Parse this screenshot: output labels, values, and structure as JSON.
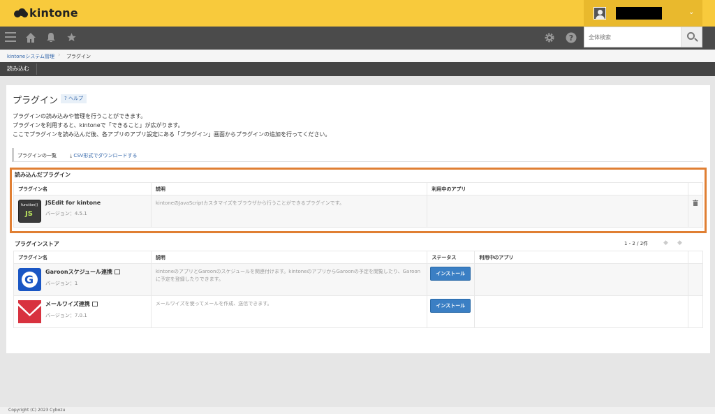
{
  "header": {
    "brand": "kintone",
    "user_name": "",
    "search_placeholder": "全体検索"
  },
  "breadcrumb": {
    "items": [
      "kintoneシステム管理",
      "プラグイン"
    ]
  },
  "actionbar": {
    "import_label": "読み込む"
  },
  "page": {
    "title": "プラグイン",
    "help_label": "? ヘルプ",
    "description": [
      "プラグインの読み込みや管理を行うことができます。",
      "プラグインを利用すると、kintoneで「できること」が広がります。",
      "ここでプラグインを読み込んだ後、各アプリのアプリ設定にある「プラグイン」画面からプラグインの追加を行ってください。"
    ],
    "list_label": "プラグインの一覧",
    "csv_link": "CSV形式でダウンロードする"
  },
  "loaded": {
    "title": "読み込んだプラグイン",
    "columns": [
      "プラグイン名",
      "説明",
      "利用中のアプリ"
    ],
    "rows": [
      {
        "name": "JSEdit for kintone",
        "version": "バージョン：4.5.1",
        "description": "kintoneのJavaScriptカスタマイズをブラウザから行うことができるプラグインです。",
        "apps": "",
        "icon_top": "function()",
        "icon_main": "JS"
      }
    ]
  },
  "store": {
    "title": "プラグインストア",
    "pager": "1 - 2 / 2件",
    "columns": [
      "プラグイン名",
      "説明",
      "ステータス",
      "利用中のアプリ"
    ],
    "rows": [
      {
        "name": "Garoonスケジュール連携",
        "version": "バージョン：1",
        "description": "kintoneのアプリとGaroonのスケジュールを関連付けます。kintoneのアプリからGaroonの予定を閲覧したり、Garoonに予定を登録したりできます。",
        "status_button": "インストール",
        "apps": "",
        "icon_letter": "G"
      },
      {
        "name": "メールワイズ連携",
        "version": "バージョン：7.0.1",
        "description": "メールワイズを使ってメールを作成、送信できます。",
        "status_button": "インストール",
        "apps": ""
      }
    ]
  },
  "footer": {
    "copyright": "Copyright (C) 2023 Cybozu"
  },
  "colors": {
    "header_yellow": "#f8ca3c",
    "nav_dark": "#4b4b4b",
    "highlight_orange": "#e07f33",
    "button_blue": "#3b7fc4"
  },
  "icons": [
    "menu-icon",
    "home-icon",
    "bell-icon",
    "star-icon",
    "gear-icon",
    "help-icon",
    "search-icon",
    "trash-icon",
    "external-link-icon",
    "download-icon"
  ]
}
